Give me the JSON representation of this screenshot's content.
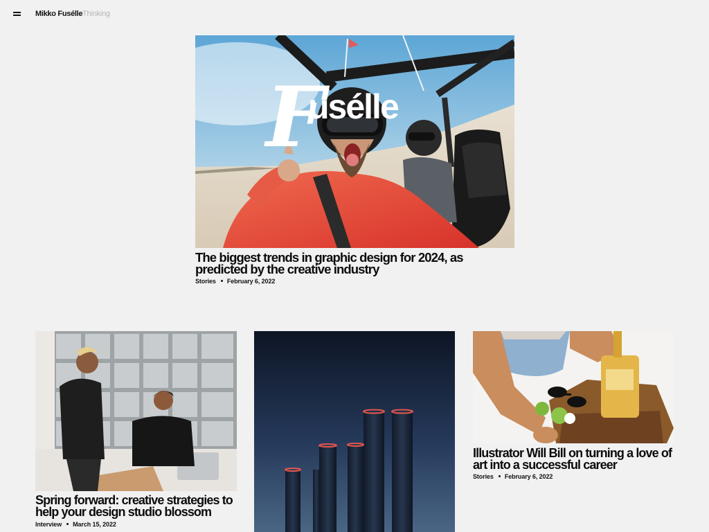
{
  "header": {
    "brand": "Mikko Fusélle",
    "nav_thinking": "Thinking"
  },
  "hero": {
    "logo_text": "Fusélle",
    "headline": "The biggest trends in graphic design for 2024, as predicted by the creative industry",
    "category": "Stories",
    "date": "February 6, 2022"
  },
  "cards": [
    {
      "headline": "Spring forward: creative strategies to help your design studio blossom",
      "category": "Interview",
      "date": "March 15, 2022"
    },
    {
      "headline": "Illustrator Will Bill on turning a love of art into a successful career",
      "category": "Stories",
      "date": "February 6, 2022"
    }
  ],
  "colors": {
    "background": "#f1f1f1",
    "text": "#111111",
    "nav_muted": "#b5b5b5"
  }
}
